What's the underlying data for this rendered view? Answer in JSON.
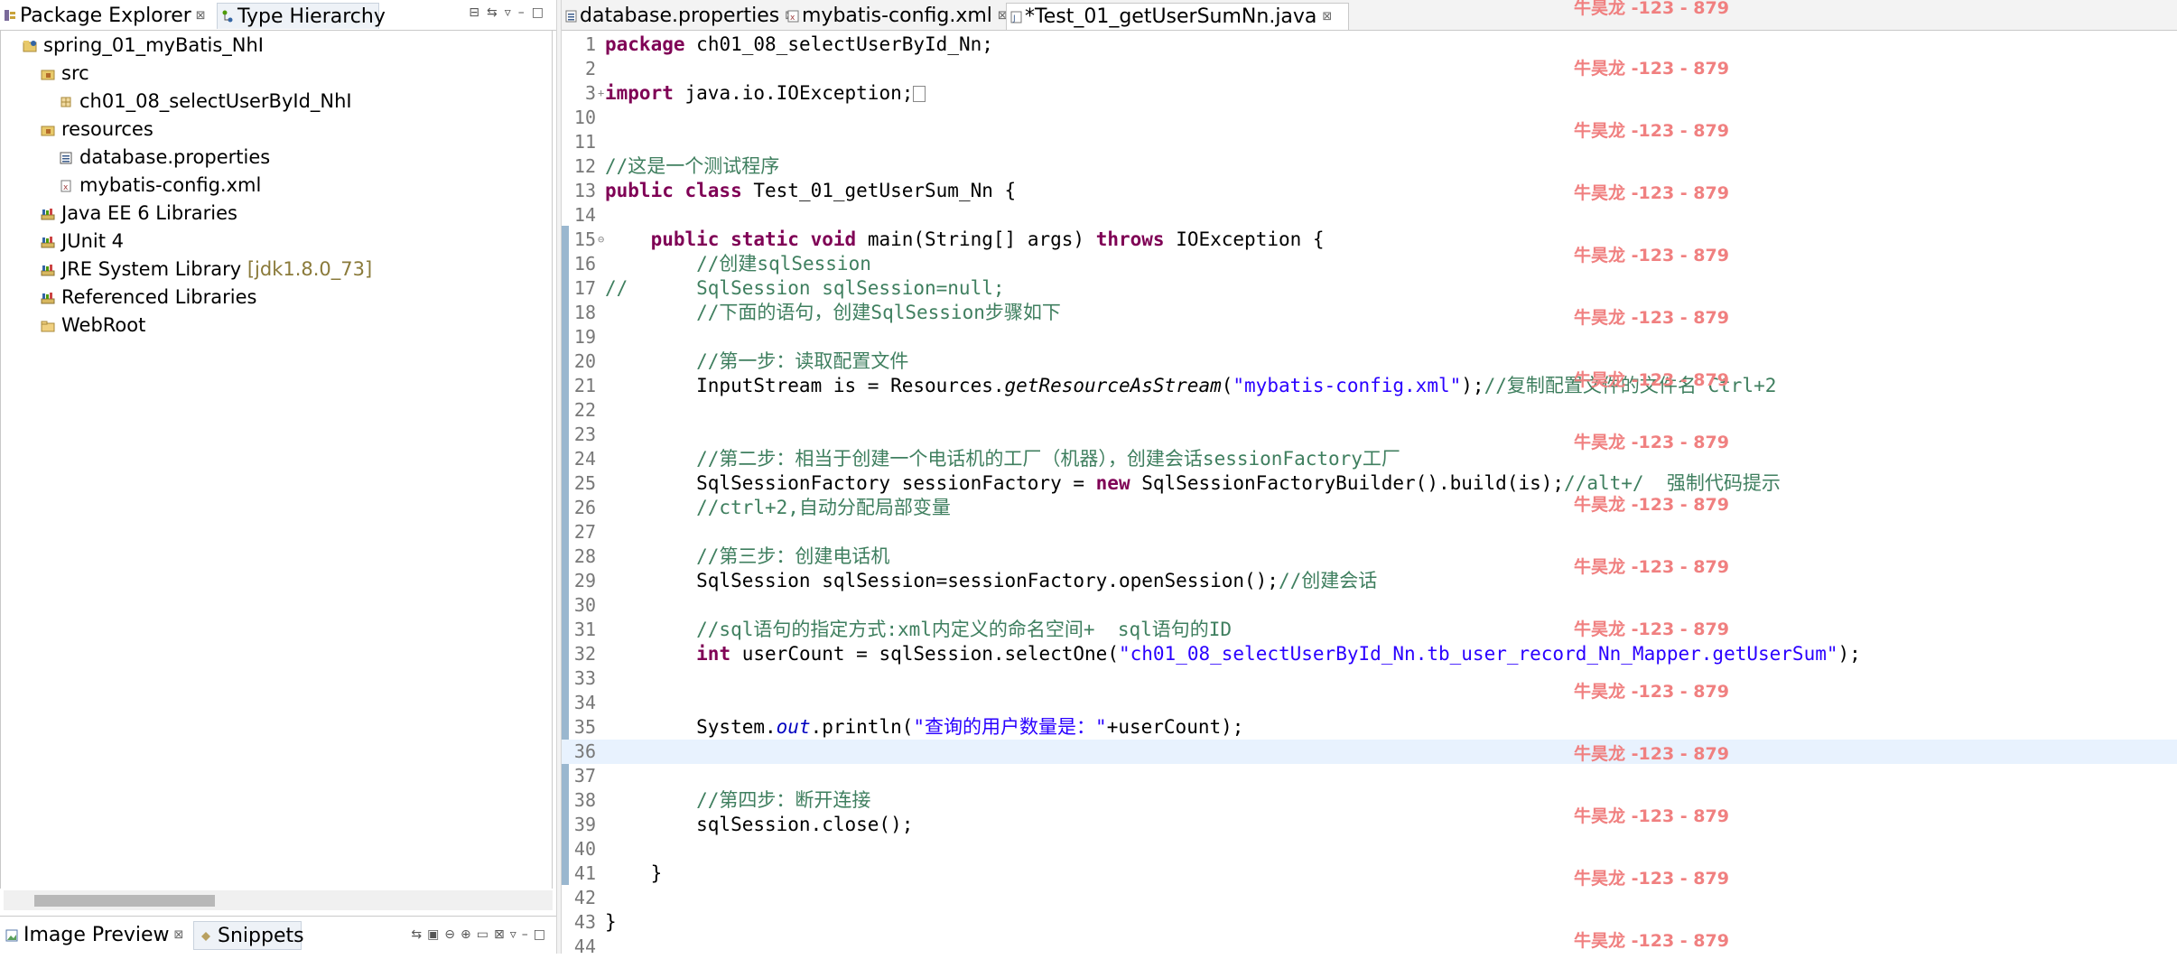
{
  "left_panel": {
    "tabs": [
      {
        "label": "Package Explorer",
        "close": "⊠"
      },
      {
        "label": "Type Hierarchy"
      }
    ],
    "tree": [
      {
        "label": "spring_01_myBatis_NhI",
        "indent": 0,
        "icon": "project-icon"
      },
      {
        "label": "src",
        "indent": 1,
        "icon": "source-folder-icon"
      },
      {
        "label": "ch01_08_selectUserById_NhI",
        "indent": 2,
        "icon": "package-icon"
      },
      {
        "label": "resources",
        "indent": 1,
        "icon": "source-folder-icon"
      },
      {
        "label": "database.properties",
        "indent": 2,
        "icon": "properties-file-icon"
      },
      {
        "label": "mybatis-config.xml",
        "indent": 2,
        "icon": "xml-file-icon"
      },
      {
        "label": "Java EE 6 Libraries",
        "indent": 1,
        "icon": "library-icon"
      },
      {
        "label": "JUnit 4",
        "indent": 1,
        "icon": "library-icon"
      },
      {
        "label": "JRE System Library",
        "suffix": "[jdk1.8.0_73]",
        "indent": 1,
        "icon": "library-icon"
      },
      {
        "label": "Referenced Libraries",
        "indent": 1,
        "icon": "library-icon"
      },
      {
        "label": "WebRoot",
        "indent": 1,
        "icon": "folder-icon"
      }
    ],
    "bottom_tabs": [
      {
        "label": "Image Preview",
        "close": "⊠"
      },
      {
        "label": "Snippets"
      }
    ]
  },
  "editor": {
    "tabs": [
      {
        "label": "database.properties",
        "close": "⊠"
      },
      {
        "label": "mybatis-config.xml",
        "close": "⊠"
      },
      {
        "label": "*Test_01_getUserSumNn.java",
        "close": "⊠",
        "active": true
      }
    ],
    "lines": [
      {
        "n": "1",
        "segs": [
          [
            "kw",
            "package"
          ],
          [
            "",
            "ch01_08_selectUserById_Nn;"
          ]
        ]
      },
      {
        "n": "2",
        "segs": []
      },
      {
        "n": "3",
        "fold": "+",
        "segs": [
          [
            "kw",
            "import"
          ],
          [
            "",
            "java.io.IOException;"
          ]
        ],
        "box": true
      },
      {
        "n": "10",
        "segs": []
      },
      {
        "n": "11",
        "segs": []
      },
      {
        "n": "12",
        "segs": [
          [
            "cm",
            "//这是一个测试程序"
          ]
        ]
      },
      {
        "n": "13",
        "segs": [
          [
            "kw",
            "public class"
          ],
          [
            "",
            "Test_01_getUserSum_Nn {"
          ]
        ]
      },
      {
        "n": "14",
        "segs": []
      },
      {
        "n": "15",
        "fold": "⊖",
        "segs": [
          [
            "",
            "    "
          ],
          [
            "kw",
            "public static void"
          ],
          [
            "",
            "main(String[] args) "
          ],
          [
            "kw",
            "throws"
          ],
          [
            "",
            "IOException {"
          ]
        ]
      },
      {
        "n": "16",
        "segs": [
          [
            "cm",
            "        //创建sqlSession"
          ]
        ]
      },
      {
        "n": "17",
        "segs": [
          [
            "cm",
            "//      SqlSession sqlSession=null;"
          ]
        ]
      },
      {
        "n": "18",
        "segs": [
          [
            "cm",
            "        //下面的语句，创建SqlSession步骤如下"
          ]
        ]
      },
      {
        "n": "19",
        "segs": []
      },
      {
        "n": "20",
        "segs": [
          [
            "cm",
            "        //第一步：读取配置文件"
          ]
        ]
      },
      {
        "n": "21",
        "segs": [
          [
            "",
            "        InputStream is = Resources."
          ],
          [
            "it",
            "getResourceAsStream"
          ],
          [
            "",
            "("
          ],
          [
            "st",
            "\"mybatis-config.xml\""
          ],
          [
            "",
            ");"
          ],
          [
            "cm",
            "//复制配置文件的文件名 Ctrl+2"
          ]
        ]
      },
      {
        "n": "22",
        "segs": []
      },
      {
        "n": "23",
        "segs": []
      },
      {
        "n": "24",
        "segs": [
          [
            "cm",
            "        //第二步：相当于创建一个电话机的工厂（机器），创建会话sessionFactory工厂"
          ]
        ]
      },
      {
        "n": "25",
        "segs": [
          [
            "",
            "        SqlSessionFactory sessionFactory = "
          ],
          [
            "kw",
            "new"
          ],
          [
            "",
            "SqlSessionFactoryBuilder().build(is);"
          ],
          [
            "cm",
            "//alt+/  强制代码提示"
          ]
        ]
      },
      {
        "n": "26",
        "segs": [
          [
            "cm",
            "        //ctrl+2,自动分配局部变量"
          ]
        ]
      },
      {
        "n": "27",
        "segs": []
      },
      {
        "n": "28",
        "segs": [
          [
            "cm",
            "        //第三步：创建电话机"
          ]
        ]
      },
      {
        "n": "29",
        "segs": [
          [
            "",
            "        SqlSession sqlSession=sessionFactory.openSession();"
          ],
          [
            "cm",
            "//创建会话"
          ]
        ]
      },
      {
        "n": "30",
        "segs": []
      },
      {
        "n": "31",
        "segs": [
          [
            "cm",
            "        //sql语句的指定方式:xml内定义的命名空间+  sql语句的ID"
          ]
        ]
      },
      {
        "n": "32",
        "segs": [
          [
            "",
            "        "
          ],
          [
            "kw",
            "int"
          ],
          [
            "",
            "userCount = sqlSession.selectOne("
          ],
          [
            "st",
            "\"ch01_08_selectUserById_Nn.tb_user_record_Nn_Mapper.getUserSum\""
          ],
          [
            "",
            ");"
          ]
        ]
      },
      {
        "n": "33",
        "segs": []
      },
      {
        "n": "34",
        "segs": []
      },
      {
        "n": "35",
        "segs": [
          [
            "",
            "        System."
          ],
          [
            "fld",
            "out"
          ],
          [
            "",
            ".println("
          ],
          [
            "st",
            "\"查询的用户数量是：\""
          ],
          [
            "",
            "+userCount);"
          ]
        ]
      },
      {
        "n": "36",
        "segs": [],
        "current": true
      },
      {
        "n": "37",
        "segs": []
      },
      {
        "n": "38",
        "segs": [
          [
            "cm",
            "        //第四步：断开连接"
          ]
        ]
      },
      {
        "n": "39",
        "segs": [
          [
            "",
            "        sqlSession.close();"
          ]
        ]
      },
      {
        "n": "40",
        "segs": []
      },
      {
        "n": "41",
        "segs": [
          [
            "",
            "    }"
          ]
        ]
      },
      {
        "n": "42",
        "segs": []
      },
      {
        "n": "43",
        "segs": [
          [
            "",
            "}"
          ]
        ]
      },
      {
        "n": "44",
        "segs": []
      }
    ],
    "watermark": "牛昊龙 -123 - 879"
  }
}
